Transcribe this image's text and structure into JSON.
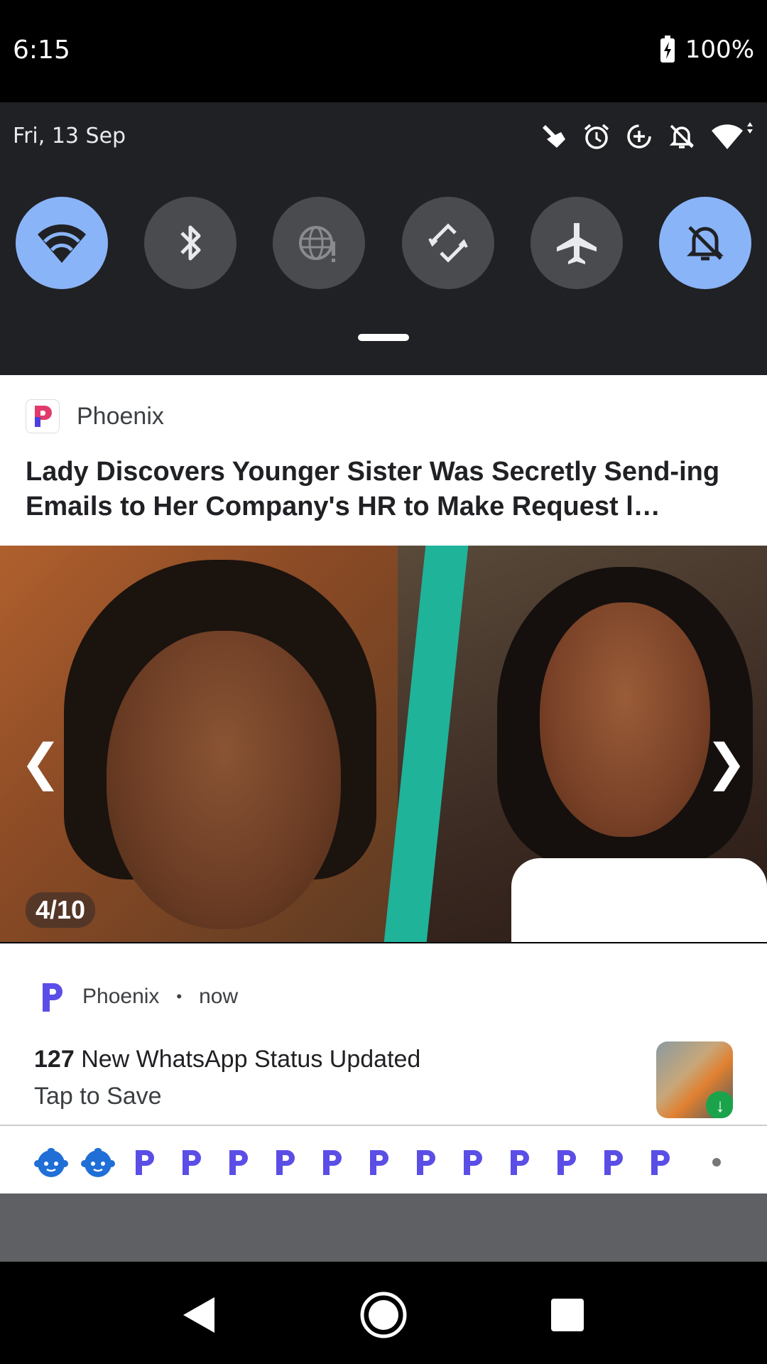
{
  "status_bar": {
    "time": "6:15",
    "battery": "100%"
  },
  "quick_settings": {
    "date": "Fri, 13 Sep",
    "status_icons": [
      "touch-icon",
      "alarm-icon",
      "data-saver-icon",
      "notifications-off-icon",
      "wifi-icon"
    ],
    "tiles": [
      {
        "name": "wifi",
        "active": true
      },
      {
        "name": "bluetooth",
        "active": false
      },
      {
        "name": "mobile-data",
        "active": false
      },
      {
        "name": "auto-rotate",
        "active": false
      },
      {
        "name": "airplane-mode",
        "active": false
      },
      {
        "name": "do-not-disturb",
        "active": true
      }
    ]
  },
  "notification1": {
    "app": "Phoenix",
    "title": "Lady Discovers Younger Sister Was Secretly Send-ing Emails to Her Company's HR to Make Request l…",
    "counter": "4/10",
    "prev_arrow": "❮",
    "next_arrow": "❯"
  },
  "notification2": {
    "app": "Phoenix",
    "separator": "•",
    "time": "now",
    "title_count": "127",
    "title_text": "New WhatsApp Status Updated",
    "subtitle": "Tap to Save"
  },
  "stacked_icons": {
    "items": [
      "baby-face-icon",
      "baby-face-icon",
      "phoenix-icon",
      "phoenix-icon",
      "phoenix-icon",
      "phoenix-icon",
      "phoenix-icon",
      "phoenix-icon",
      "phoenix-icon",
      "phoenix-icon",
      "phoenix-icon",
      "phoenix-icon",
      "phoenix-icon",
      "phoenix-icon"
    ]
  },
  "colors": {
    "accent": "#8ab4f8",
    "phoenix_purple": "#5b4ee6",
    "baby_blue": "#1f6fd6"
  }
}
